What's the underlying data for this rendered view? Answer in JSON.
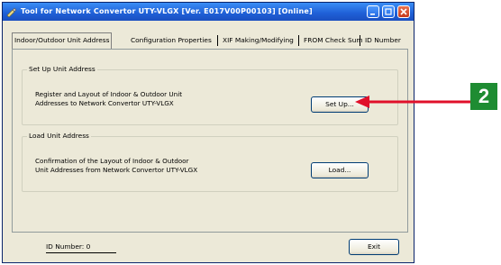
{
  "window": {
    "title": "Tool for Network Convertor UTY-VLGX [Ver. E017V00P00103] [Online]"
  },
  "tabs": [
    {
      "label": "Indoor/Outdoor Unit Address",
      "active": true
    },
    {
      "label": "Configuration Properties",
      "active": false
    },
    {
      "label": "XIF Making/Modifying",
      "active": false
    },
    {
      "label": "FROM Check Sum",
      "active": false
    },
    {
      "label": "ID Number",
      "active": false
    }
  ],
  "setup_group": {
    "title": "Set Up Unit Address",
    "line1": "Register and Layout of Indoor & Outdoor Unit",
    "line2": "Addresses to Network Convertor UTY-VLGX",
    "button_label": "Set Up..."
  },
  "load_group": {
    "title": "Load Unit Address",
    "line1": "Confirmation of the Layout of Indoor & Outdoor",
    "line2": "Unit Addresses from Network Convertor UTY-VLGX",
    "button_label": "Load..."
  },
  "footer": {
    "id_number": "ID Number:  0",
    "exit_label": "Exit"
  },
  "callout": {
    "number": "2",
    "badge_color": "#1e8c32",
    "arrow_color": "#e0102a"
  }
}
